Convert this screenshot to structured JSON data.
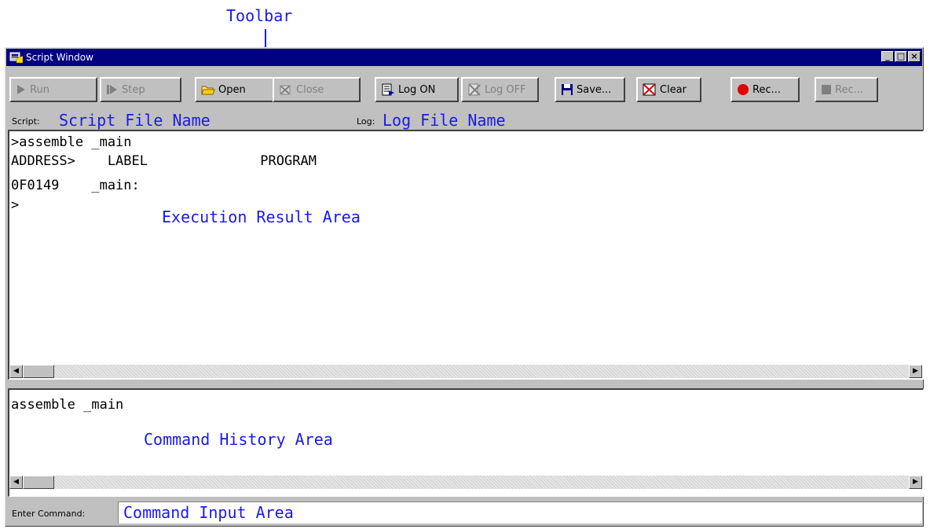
{
  "annotations": {
    "toolbar": "Toolbar"
  },
  "window": {
    "title": "Script Window",
    "caption_buttons": {
      "minimize": "_",
      "maximize": "□",
      "close": "×"
    }
  },
  "toolbar": {
    "run": "Run",
    "step": "Step",
    "open": "Open",
    "close": "Close",
    "log_on": "Log ON",
    "log_off": "Log OFF",
    "save": "Save...",
    "clear": "Clear",
    "rec_start": "Rec...",
    "rec_stop": "Rec..."
  },
  "pathbar": {
    "script_label": "Script:",
    "script_value": "Script File Name",
    "log_label": "Log:",
    "log_value": "Log File Name"
  },
  "result_area": {
    "lines": [
      ">assemble _main",
      "ADDRESS>    LABEL              PROGRAM",
      "0F0149    _main:",
      ">"
    ],
    "annotation": "Execution Result Area"
  },
  "history_area": {
    "lines": [
      "assemble _main"
    ],
    "annotation": "Command History Area"
  },
  "command": {
    "label": "Enter Command:",
    "value": "Command Input Area"
  },
  "icons": {
    "run": "play-icon",
    "step": "step-icon",
    "open": "open-folder-icon",
    "close": "close-script-icon",
    "log_on": "log-on-icon",
    "log_off": "log-off-icon",
    "save": "floppy-disk-icon",
    "clear": "clear-icon",
    "rec_start": "record-icon",
    "rec_stop": "stop-icon"
  },
  "colors": {
    "titlebar": "#000080",
    "annotation": "#1a1ae6",
    "chrome": "#c0c0c0"
  }
}
